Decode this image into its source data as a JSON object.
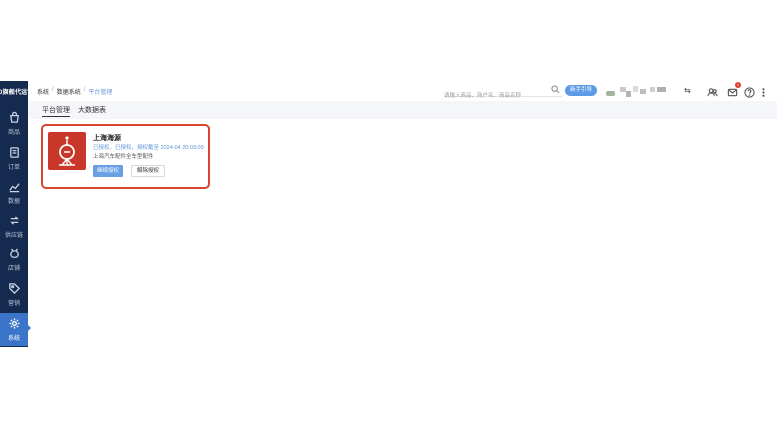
{
  "sidebar": {
    "logo_text": "JD旗舰代运营",
    "items": [
      {
        "label": "商品",
        "icon": "bag-icon"
      },
      {
        "label": "订单",
        "icon": "order-icon"
      },
      {
        "label": "数据",
        "icon": "chart-icon"
      },
      {
        "label": "供应链",
        "icon": "supply-chain-icon"
      },
      {
        "label": "店铺",
        "icon": "store-icon"
      },
      {
        "label": "营销",
        "icon": "tag-icon"
      },
      {
        "label": "系统",
        "icon": "gear-icon",
        "active": true
      }
    ]
  },
  "breadcrumb": {
    "items": [
      "系统",
      "数据系统",
      "平台管理"
    ]
  },
  "search": {
    "placeholder": "请输入商品、商户名、商品名称"
  },
  "header": {
    "pill_label": "新手引导",
    "shop_switch": "⇆",
    "badge_count": "1"
  },
  "tabs": [
    {
      "label": "平台管理",
      "active": true
    },
    {
      "label": "大数据表",
      "active": false
    }
  ],
  "card": {
    "title": "上海海源",
    "status": "已授权，已授权，授权截至 2024-04 20:03:00",
    "description": "上海汽车配件全车型配件",
    "primary_button": "继续授权",
    "secondary_button": "解除授权"
  },
  "colors": {
    "sidebar_bg": "#142a4f",
    "accent": "#3a75c9",
    "highlight_border": "#d9452d",
    "logo_bg": "#c9362a"
  }
}
